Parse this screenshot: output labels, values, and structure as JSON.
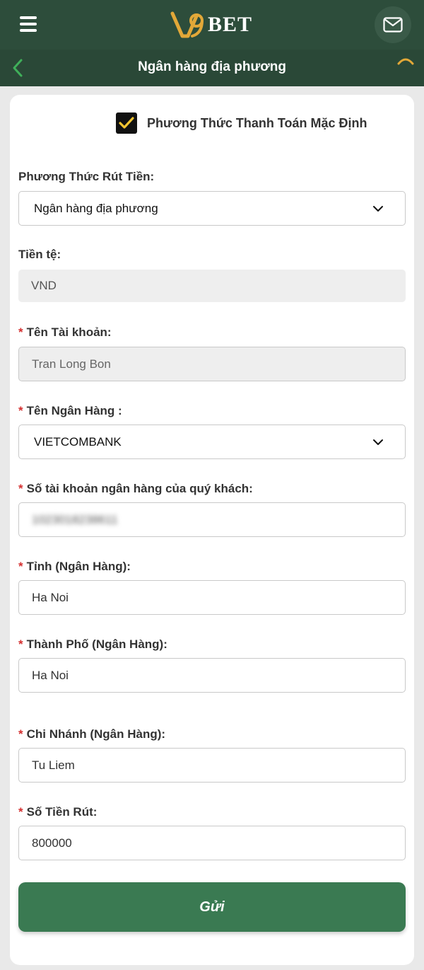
{
  "header": {
    "logo_text": "BET",
    "logo_mark": "V9",
    "menu_icon": "hamburger-menu-icon",
    "mail_icon": "mail-icon"
  },
  "subheader": {
    "title": "Ngân hàng địa phương",
    "back_icon": "chevron-left-icon",
    "loader_icon": "loading-arc-icon"
  },
  "form": {
    "default_method_label": "Phương Thức Thanh Toán Mặc Định",
    "default_method_checked": true,
    "withdraw_method_label": "Phương Thức Rút Tiền:",
    "withdraw_method_value": "Ngân hàng địa phương",
    "currency_label": "Tiền tệ:",
    "currency_value": "VND",
    "account_name_label": "Tên Tài khoản:",
    "account_name_value": "Tran Long Bon",
    "bank_name_label": "Tên Ngân Hàng :",
    "bank_name_value": "VIETCOMBANK",
    "account_number_label": "Số tài khoản ngân hàng của quý khách:",
    "account_number_value": "1023018238611",
    "province_label": "Tỉnh (Ngân Hàng):",
    "province_value": "Ha Noi",
    "city_label": "Thành Phố (Ngân Hàng):",
    "city_value": "Ha Noi",
    "branch_label": "Chi Nhánh (Ngân Hàng):",
    "branch_value": "Tu Liem",
    "amount_label": "Số Tiền Rút:",
    "amount_value": "800000",
    "required_mark": "*",
    "submit_label": "Gửi"
  },
  "colors": {
    "header_bg": "#2d4d3b",
    "subheader_bg": "#2a4837",
    "accent_gold": "#e2a838",
    "submit_bg": "#3a7a52",
    "required": "#d43030"
  }
}
